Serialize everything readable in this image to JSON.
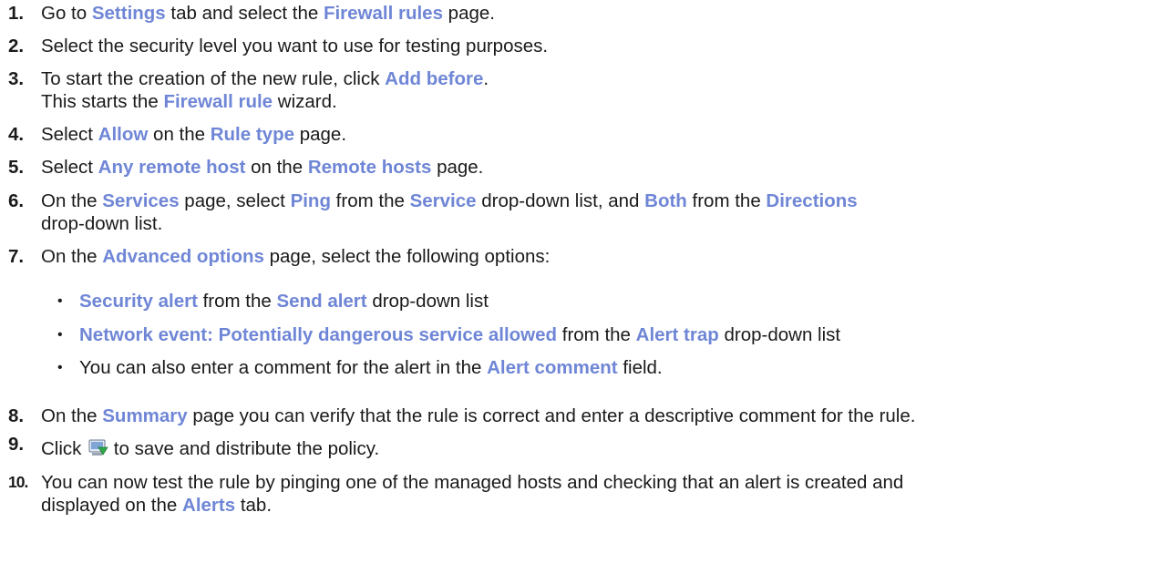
{
  "steps": [
    {
      "num": "1.",
      "lines": [
        [
          {
            "t": "Go to "
          },
          {
            "t": "Settings",
            "ui": true
          },
          {
            "t": " tab and select the "
          },
          {
            "t": "Firewall rules",
            "ui": true
          },
          {
            "t": " page."
          }
        ]
      ]
    },
    {
      "num": "2.",
      "lines": [
        [
          {
            "t": "Select the security level you want to use for testing purposes."
          }
        ]
      ]
    },
    {
      "num": "3.",
      "lines": [
        [
          {
            "t": "To start the creation of the new rule, click "
          },
          {
            "t": "Add before",
            "ui": true
          },
          {
            "t": "."
          }
        ],
        [
          {
            "t": "This starts the "
          },
          {
            "t": "Firewall rule",
            "ui": true
          },
          {
            "t": " wizard."
          }
        ]
      ]
    },
    {
      "num": "4.",
      "lines": [
        [
          {
            "t": "Select "
          },
          {
            "t": "Allow",
            "ui": true
          },
          {
            "t": " on the "
          },
          {
            "t": "Rule type",
            "ui": true
          },
          {
            "t": " page."
          }
        ]
      ]
    },
    {
      "num": "5.",
      "lines": [
        [
          {
            "t": "Select "
          },
          {
            "t": "Any remote host",
            "ui": true
          },
          {
            "t": " on the "
          },
          {
            "t": "Remote hosts",
            "ui": true
          },
          {
            "t": " page."
          }
        ]
      ]
    },
    {
      "num": "6.",
      "lines": [
        [
          {
            "t": "On the "
          },
          {
            "t": "Services",
            "ui": true
          },
          {
            "t": " page, select "
          },
          {
            "t": "Ping",
            "ui": true
          },
          {
            "t": " from the "
          },
          {
            "t": "Service",
            "ui": true
          },
          {
            "t": " drop-down list, and "
          },
          {
            "t": "Both",
            "ui": true
          },
          {
            "t": " from the "
          },
          {
            "t": "Directions",
            "ui": true
          }
        ],
        [
          {
            "t": "drop-down list."
          }
        ]
      ]
    },
    {
      "num": "7.",
      "lines": [
        [
          {
            "t": "On the "
          },
          {
            "t": "Advanced options",
            "ui": true
          },
          {
            "t": " page, select the following options:"
          }
        ]
      ]
    },
    {
      "num": "8.",
      "lines": [
        [
          {
            "t": "On the "
          },
          {
            "t": "Summary",
            "ui": true
          },
          {
            "t": " page you can verify that the rule is correct and enter a descriptive comment for the rule."
          }
        ]
      ]
    },
    {
      "num": "9.",
      "lines": [
        [
          {
            "t": "Click "
          },
          {
            "icon": "save-and-distribute-icon"
          },
          {
            "t": " to save and distribute the policy."
          }
        ]
      ]
    },
    {
      "num": "10.",
      "lines": [
        [
          {
            "t": "You can now test the rule by pinging one of the managed hosts and checking that an alert is created and"
          }
        ],
        [
          {
            "t": "displayed on the "
          },
          {
            "t": "Alerts",
            "ui": true
          },
          {
            "t": " tab."
          }
        ]
      ]
    }
  ],
  "bullets": [
    [
      {
        "t": "Security alert",
        "ui": true
      },
      {
        "t": " from the "
      },
      {
        "t": "Send alert",
        "ui": true
      },
      {
        "t": " drop-down list"
      }
    ],
    [
      {
        "t": "Network event: Potentially dangerous service allowed",
        "ui": true
      },
      {
        "t": " from the "
      },
      {
        "t": "Alert trap",
        "ui": true
      },
      {
        "t": " drop-down list"
      }
    ],
    [
      {
        "t": "You can also enter a comment for the alert in the "
      },
      {
        "t": "Alert comment",
        "ui": true
      },
      {
        "t": " field."
      }
    ]
  ],
  "bullet_glyph": "•",
  "colors": {
    "ui_term": "#6f86d6",
    "text": "#1a1a1a"
  }
}
